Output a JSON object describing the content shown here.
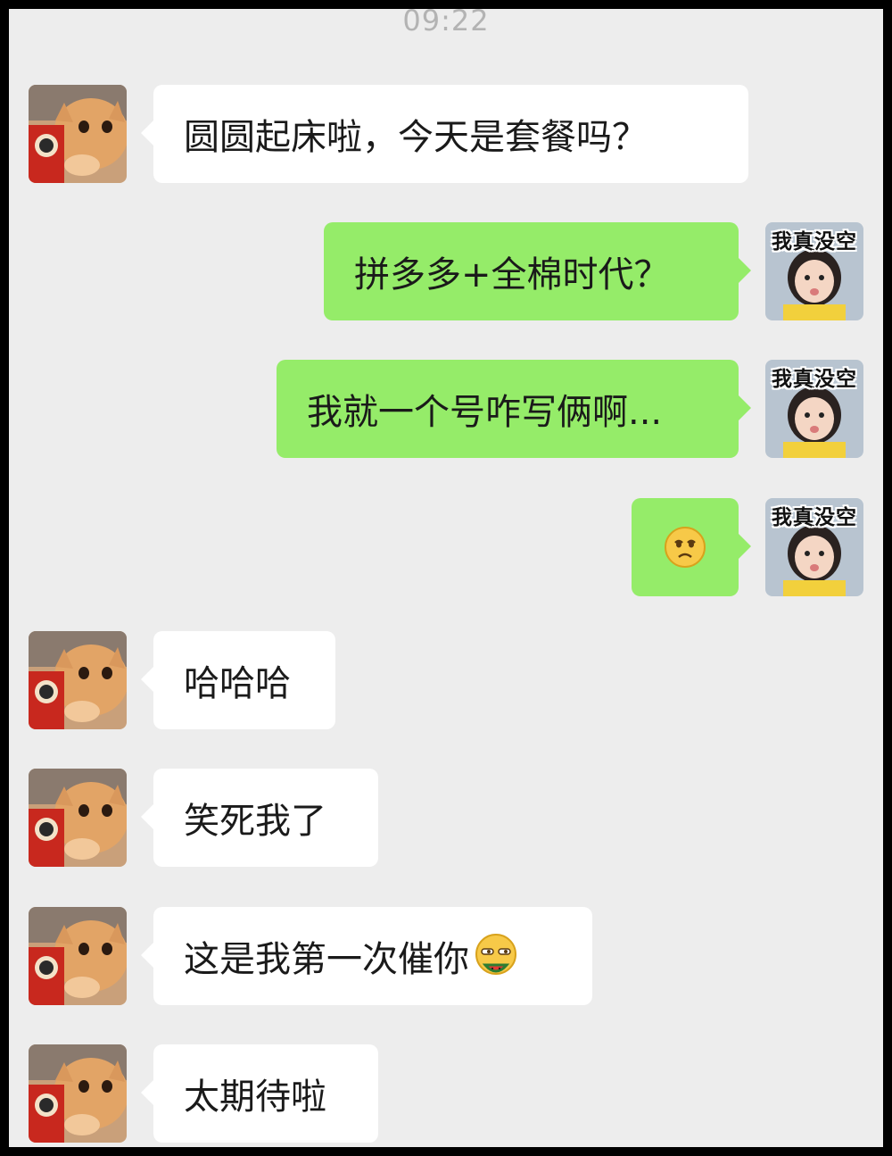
{
  "status_bar": {
    "time": "09:22"
  },
  "messages": [
    {
      "side": "left",
      "text": "圆圆起床啦，今天是套餐吗？"
    },
    {
      "side": "right",
      "text": "拼多多+全棉时代？"
    },
    {
      "side": "right",
      "text": "我就一个号咋写俩啊..."
    },
    {
      "side": "right",
      "emoji": "sad-face-emoji"
    },
    {
      "side": "left",
      "text": "哈哈哈"
    },
    {
      "side": "left",
      "text": "笑死我了"
    },
    {
      "side": "left",
      "text": "这是我第一次催你",
      "emoji": "watermelon-eating-emoji"
    },
    {
      "side": "left",
      "text": "太期待啦"
    }
  ],
  "avatars": {
    "contact": {
      "icon": "cat-avatar"
    },
    "self": {
      "icon": "girl-avatar",
      "caption": "我真没空"
    }
  },
  "colors": {
    "background": "#ededed",
    "outgoing_bubble": "#95ec69",
    "incoming_bubble": "#ffffff",
    "time_text": "#b3b3b3"
  }
}
